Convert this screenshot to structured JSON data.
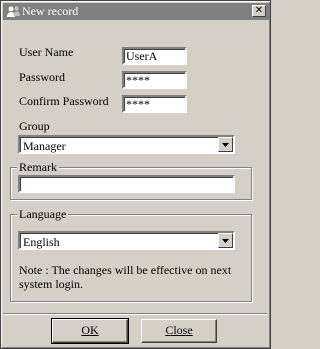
{
  "window": {
    "title": "New record",
    "close_glyph": "✕",
    "icon": "users-icon"
  },
  "fields": {
    "user_name": {
      "label": "User Name",
      "value": "UserA"
    },
    "password": {
      "label": "Password",
      "value": "****"
    },
    "confirm_password": {
      "label": "Confirm Password",
      "value": "****"
    }
  },
  "group": {
    "label": "Group",
    "selected": "Manager"
  },
  "remark": {
    "label": "Remark",
    "value": ""
  },
  "language": {
    "label": "Language",
    "selected": "English",
    "note": "Note : The changes will be effective on next system login."
  },
  "buttons": {
    "ok": "OK",
    "close": "Close"
  }
}
